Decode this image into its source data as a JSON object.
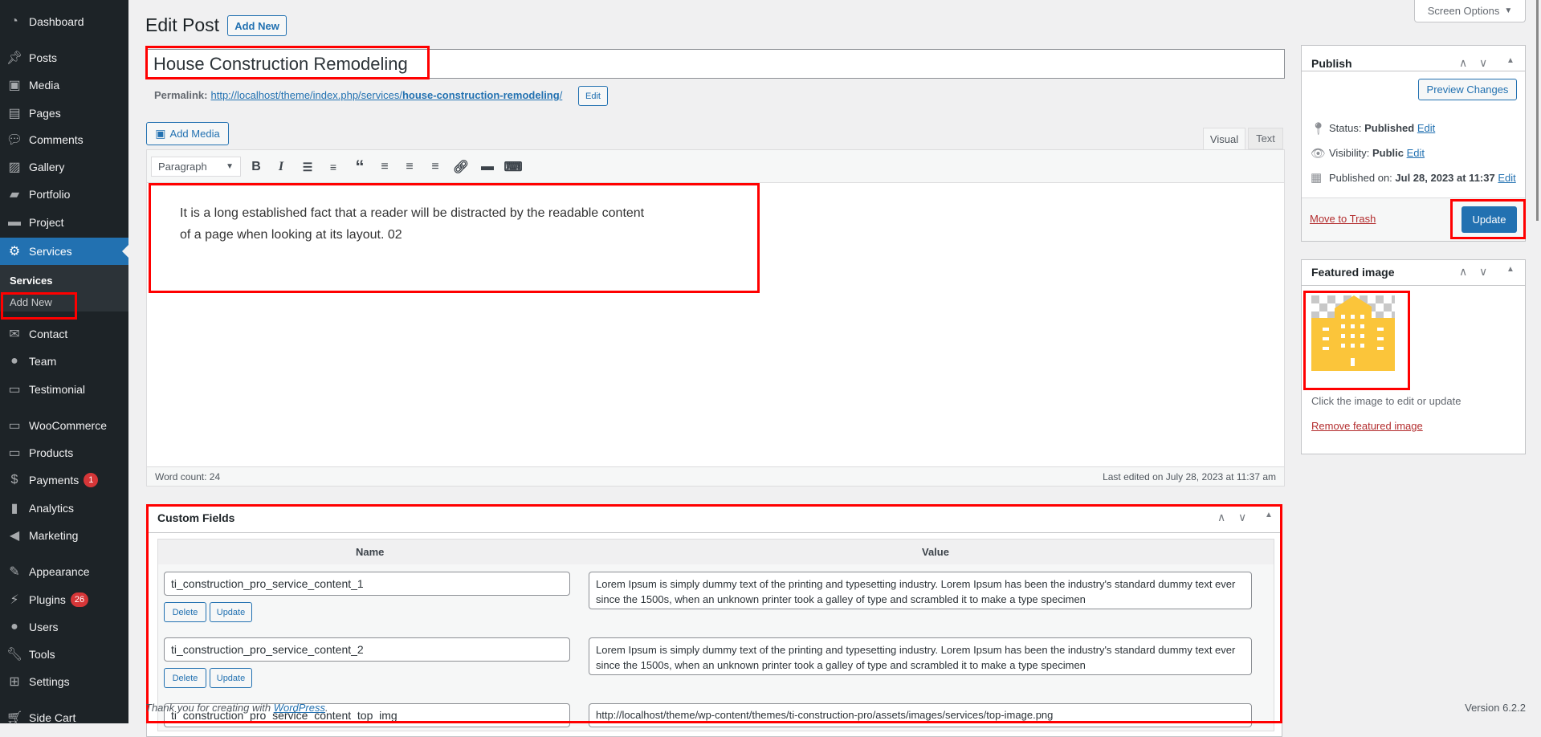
{
  "sidebar": {
    "items": [
      {
        "label": "Dashboard",
        "icon": "dashboard-icon"
      },
      {
        "label": "Posts",
        "icon": "pin-icon"
      },
      {
        "label": "Media",
        "icon": "media-icon"
      },
      {
        "label": "Pages",
        "icon": "pages-icon"
      },
      {
        "label": "Comments",
        "icon": "comment-icon"
      },
      {
        "label": "Gallery",
        "icon": "gallery-icon"
      },
      {
        "label": "Portfolio",
        "icon": "folder-icon"
      },
      {
        "label": "Project",
        "icon": "project-icon"
      },
      {
        "label": "Services",
        "icon": "services-icon",
        "active": true
      },
      {
        "label": "Contact",
        "icon": "mail-icon"
      },
      {
        "label": "Team",
        "icon": "person-icon"
      },
      {
        "label": "Testimonial",
        "icon": "testimonial-icon"
      },
      {
        "label": "WooCommerce",
        "icon": "woo-icon"
      },
      {
        "label": "Products",
        "icon": "archive-icon"
      },
      {
        "label": "Payments",
        "icon": "dollar-icon",
        "badge": "1"
      },
      {
        "label": "Analytics",
        "icon": "bar-chart-icon"
      },
      {
        "label": "Marketing",
        "icon": "megaphone-icon"
      },
      {
        "label": "Appearance",
        "icon": "brush-icon"
      },
      {
        "label": "Plugins",
        "icon": "plugin-icon",
        "badge": "26"
      },
      {
        "label": "Users",
        "icon": "users-icon"
      },
      {
        "label": "Tools",
        "icon": "wrench-icon"
      },
      {
        "label": "Settings",
        "icon": "settings-icon"
      },
      {
        "label": "Side Cart",
        "icon": "cart-icon"
      }
    ],
    "submenu": {
      "current": "Services",
      "add_new": "Add New"
    }
  },
  "header": {
    "title": "Edit Post",
    "add_new": "Add New",
    "screen_options": "Screen Options"
  },
  "post": {
    "title": "House Construction Remodeling",
    "permalink_label": "Permalink:",
    "permalink_base": "http://localhost/theme/index.php/services/",
    "permalink_slug": "house-construction-remodeling",
    "permalink_trail": "/",
    "permalink_edit": "Edit"
  },
  "editor": {
    "add_media": "Add Media",
    "tab_visual": "Visual",
    "tab_text": "Text",
    "format_select": "Paragraph",
    "content_line1": "It is a long established fact that a reader will be distracted by the readable content",
    "content_line2": "of a page when looking at its layout. 02",
    "word_count": "Word count: 24",
    "last_edited": "Last edited on July 28, 2023 at 11:37 am"
  },
  "custom_fields": {
    "title": "Custom Fields",
    "col_name": "Name",
    "col_value": "Value",
    "delete": "Delete",
    "update": "Update",
    "rows": [
      {
        "name": "ti_construction_pro_service_content_1",
        "value": "Lorem Ipsum is simply dummy text of the printing and typesetting industry. Lorem Ipsum has been the industry's standard dummy text ever since the 1500s, when an unknown printer took a galley of type and scrambled it to make a type specimen"
      },
      {
        "name": "ti_construction_pro_service_content_2",
        "value": "Lorem Ipsum is simply dummy text of the printing and typesetting industry. Lorem Ipsum has been the industry's standard dummy text ever since the 1500s, when an unknown printer took a galley of type and scrambled it to make a type specimen"
      },
      {
        "name": "ti_construction_pro_service_content_top_img",
        "value": "http://localhost/theme/wp-content/themes/ti-construction-pro/assets/images/services/top-image.png"
      }
    ]
  },
  "publish": {
    "title": "Publish",
    "preview": "Preview Changes",
    "status_label": "Status:",
    "status_value": "Published",
    "visibility_label": "Visibility:",
    "visibility_value": "Public",
    "published_label": "Published on:",
    "published_value": "Jul 28, 2023 at 11:37",
    "edit": "Edit",
    "trash": "Move to Trash",
    "update": "Update"
  },
  "featured": {
    "title": "Featured image",
    "hint": "Click the image to edit or update",
    "remove": "Remove featured image"
  },
  "footer": {
    "thanks": "Thank you for creating with ",
    "wp_link": "WordPress",
    "period": ".",
    "version": "Version 6.2.2"
  },
  "colors": {
    "accent": "#2271b1",
    "sidebar": "#1d2327",
    "highlight": "#ff0000",
    "danger": "#d63638",
    "image": "#fbc53a"
  }
}
